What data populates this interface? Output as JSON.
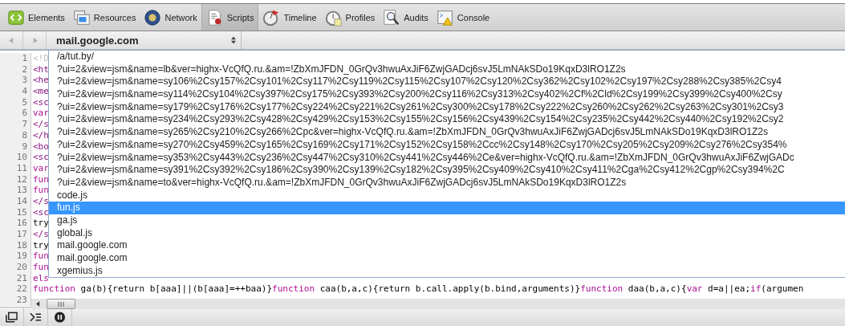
{
  "tabs": [
    {
      "label": "Elements",
      "selected": false
    },
    {
      "label": "Resources",
      "selected": false
    },
    {
      "label": "Network",
      "selected": false
    },
    {
      "label": "Scripts",
      "selected": true
    },
    {
      "label": "Timeline",
      "selected": false
    },
    {
      "label": "Profiles",
      "selected": false
    },
    {
      "label": "Audits",
      "selected": false
    },
    {
      "label": "Console",
      "selected": false
    }
  ],
  "nav": {
    "back_disabled": true,
    "forward_disabled": true
  },
  "script_select": {
    "value": "mail.google.com"
  },
  "code_lines": [
    {
      "number": "1",
      "segments": [
        {
          "text": "<!D",
          "kind": "doctype"
        }
      ]
    },
    {
      "number": "2",
      "segments": [
        {
          "text": "<ht",
          "kind": "tag"
        }
      ]
    },
    {
      "number": "3",
      "segments": [
        {
          "text": "<he",
          "kind": "tag"
        }
      ]
    },
    {
      "number": "4",
      "segments": [
        {
          "text": "<me",
          "kind": "tag"
        }
      ]
    },
    {
      "number": "5",
      "segments": [
        {
          "text": "<sc",
          "kind": "tag"
        }
      ]
    },
    {
      "number": "6",
      "segments": [
        {
          "text": "var",
          "kind": "keyword"
        }
      ]
    },
    {
      "number": "7",
      "segments": [
        {
          "text": "</s",
          "kind": "tag"
        }
      ]
    },
    {
      "number": "8",
      "segments": [
        {
          "text": "</h",
          "kind": "tag"
        }
      ]
    },
    {
      "number": "9",
      "segments": [
        {
          "text": "<bo",
          "kind": "tag"
        }
      ]
    },
    {
      "number": "10",
      "segments": [
        {
          "text": "<sc",
          "kind": "tag"
        }
      ]
    },
    {
      "number": "11",
      "segments": [
        {
          "text": "var",
          "kind": "keyword"
        }
      ]
    },
    {
      "number": "12",
      "segments": [
        {
          "text": "fun",
          "kind": "keyword"
        }
      ]
    },
    {
      "number": "13",
      "segments": [
        {
          "text": "fun",
          "kind": "keyword"
        }
      ]
    },
    {
      "number": "14",
      "segments": [
        {
          "text": "</s",
          "kind": "tag"
        }
      ]
    },
    {
      "number": "15",
      "segments": [
        {
          "text": "<sc",
          "kind": "tag"
        }
      ]
    },
    {
      "number": "16",
      "segments": [
        {
          "text": "try",
          "kind": "plain"
        }
      ]
    },
    {
      "number": "17",
      "segments": [
        {
          "text": "</s",
          "kind": "tag"
        }
      ]
    },
    {
      "number": "18",
      "segments": [
        {
          "text": "try",
          "kind": "plain"
        }
      ]
    },
    {
      "number": "19",
      "segments": [
        {
          "text": "fun",
          "kind": "keyword"
        }
      ]
    },
    {
      "number": "20",
      "segments": [
        {
          "text": "fun",
          "kind": "keyword"
        }
      ]
    },
    {
      "number": "21",
      "segments": [
        {
          "text": "els",
          "kind": "keyword"
        }
      ]
    },
    {
      "number": "22",
      "segments": [
        {
          "text": "function",
          "kind": "keyword"
        },
        {
          "text": " ga(b){return b[aaa]||(b[aaa]=++baa)}",
          "kind": "plain"
        },
        {
          "text": "function",
          "kind": "keyword"
        },
        {
          "text": " caa(b,a,c){return b.call.apply(b.bind,arguments)}",
          "kind": "plain"
        },
        {
          "text": "function",
          "kind": "keyword"
        },
        {
          "text": " daa(b,a,c){",
          "kind": "plain"
        },
        {
          "text": "var",
          "kind": "keyword"
        },
        {
          "text": " d=a||ea;",
          "kind": "plain"
        },
        {
          "text": "if",
          "kind": "keyword"
        },
        {
          "text": "(argumen",
          "kind": "plain"
        }
      ]
    },
    {
      "number": "23"
    }
  ],
  "dropdown": [
    {
      "label": "/a/tut.by/",
      "selected": false
    },
    {
      "label": "?ui=2&view=jsm&name=lb&ver=highx-VcQfQ.ru.&am=!ZbXmJFDN_0GrQv3hwuAxJiF6ZwjGADcj6svJ5LmNAkSDo19KqxD3lRO1Z2s",
      "selected": false
    },
    {
      "label": "?ui=2&view=jsm&name=sy106%2Csy157%2Csy101%2Csy117%2Csy119%2Csy115%2Csy107%2Csy120%2Csy362%2Csy102%2Csy197%2Csy288%2Csy385%2Csy4",
      "selected": false
    },
    {
      "label": "?ui=2&view=jsm&name=sy114%2Csy104%2Csy397%2Csy175%2Csy393%2Csy200%2Csy116%2Csy313%2Csy402%2Cf%2Cld%2Csy199%2Csy399%2Csy400%2Csy",
      "selected": false
    },
    {
      "label": "?ui=2&view=jsm&name=sy179%2Csy176%2Csy177%2Csy224%2Csy221%2Csy261%2Csy300%2Csy178%2Csy222%2Csy260%2Csy262%2Csy263%2Csy301%2Csy3",
      "selected": false
    },
    {
      "label": "?ui=2&view=jsm&name=sy234%2Csy293%2Csy428%2Csy429%2Csy153%2Csy155%2Csy156%2Csy439%2Csy154%2Csy235%2Csy442%2Csy440%2Csy192%2Csy2",
      "selected": false
    },
    {
      "label": "?ui=2&view=jsm&name=sy265%2Csy210%2Csy266%2Cpc&ver=highx-VcQfQ.ru.&am=!ZbXmJFDN_0GrQv3hwuAxJiF6ZwjGADcj6svJ5LmNAkSDo19KqxD3lRO1Z2s",
      "selected": false
    },
    {
      "label": "?ui=2&view=jsm&name=sy270%2Csy459%2Csy165%2Csy169%2Csy171%2Csy152%2Csy158%2Ccc%2Csy148%2Csy170%2Csy205%2Csy209%2Csy276%2Csy354%",
      "selected": false
    },
    {
      "label": "?ui=2&view=jsm&name=sy353%2Csy443%2Csy236%2Csy447%2Csy310%2Csy441%2Csy446%2Ce&ver=highx-VcQfQ.ru.&am=!ZbXmJFDN_0GrQv3hwuAxJiF6ZwjGADc",
      "selected": false
    },
    {
      "label": "?ui=2&view=jsm&name=sy391%2Csy392%2Csy186%2Csy390%2Csy139%2Csy182%2Csy395%2Csy409%2Csy410%2Csy411%2Cga%2Csy412%2Cgp%2Csy394%2C",
      "selected": false
    },
    {
      "label": "?ui=2&view=jsm&name=to&ver=highx-VcQfQ.ru.&am=!ZbXmJFDN_0GrQv3hwuAxJiF6ZwjGADcj6svJ5LmNAkSDo19KqxD3lRO1Z2s",
      "selected": false
    },
    {
      "label": "code.js",
      "selected": false
    },
    {
      "label": "fun.js",
      "selected": true
    },
    {
      "label": "ga.js",
      "selected": false
    },
    {
      "label": "global.js",
      "selected": false
    },
    {
      "label": "mail.google.com",
      "selected": false
    },
    {
      "label": "mail.google.com",
      "selected": false
    },
    {
      "label": "xgemius.js",
      "selected": false
    }
  ]
}
